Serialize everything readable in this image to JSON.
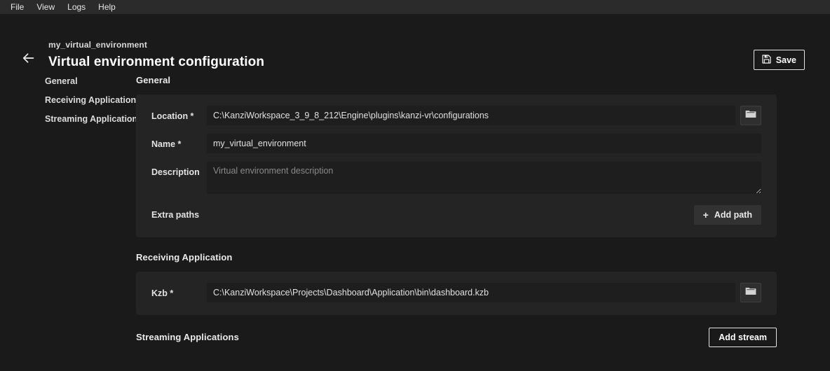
{
  "menubar": {
    "items": [
      {
        "label": "File"
      },
      {
        "label": "View"
      },
      {
        "label": "Logs"
      },
      {
        "label": "Help"
      }
    ]
  },
  "header": {
    "back_icon": "arrow-left-icon",
    "breadcrumb": "my_virtual_environment",
    "title": "Virtual environment configuration",
    "save": {
      "label": "Save",
      "icon": "floppy-disk-save-icon"
    }
  },
  "sidebar": {
    "items": [
      {
        "label": "General"
      },
      {
        "label": "Receiving Application"
      },
      {
        "label": "Streaming Applications"
      }
    ]
  },
  "general": {
    "section_title": "General",
    "location": {
      "label": "Location *",
      "value": "C:\\KanziWorkspace_3_9_8_212\\Engine\\plugins\\kanzi-vr\\configurations",
      "placeholder": "",
      "browse_icon": "folder-icon"
    },
    "name": {
      "label": "Name *",
      "value": "my_virtual_environment",
      "placeholder": ""
    },
    "description": {
      "label": "Description",
      "value": "",
      "placeholder": "Virtual environment description"
    },
    "extra_paths": {
      "label": "Extra paths",
      "add_button_label": "Add path",
      "add_button_icon": "plus-icon"
    }
  },
  "receiving_application": {
    "section_title": "Receiving Application",
    "kzb": {
      "label": "Kzb *",
      "value": "C:\\KanziWorkspace\\Projects\\Dashboard\\Application\\bin\\dashboard.kzb",
      "placeholder": "",
      "browse_icon": "folder-icon"
    }
  },
  "streaming_applications": {
    "section_title": "Streaming Applications",
    "add_stream_label": "Add stream"
  },
  "colors": {
    "app_background": "#1a1a1a",
    "menubar_background": "#2b2b2b",
    "panel_background": "#242424",
    "input_background": "#1e1e1e",
    "button_background": "#323232",
    "text_primary": "#e8e8e8",
    "text_placeholder": "#8a8a8a",
    "outline": "#e3e3e3"
  }
}
